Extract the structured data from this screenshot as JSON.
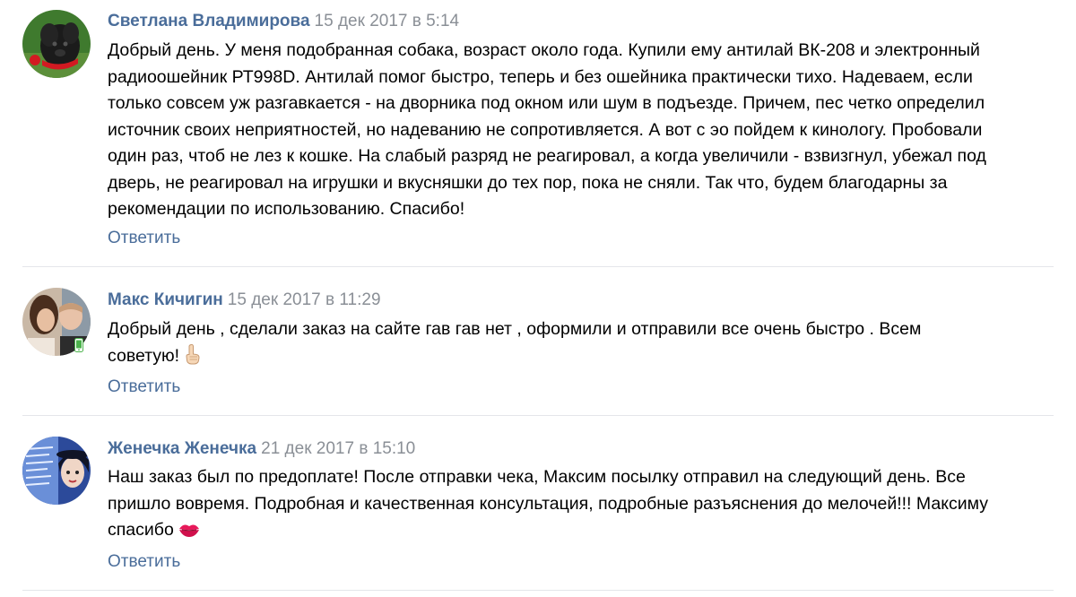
{
  "comments": [
    {
      "author": "Светлана Владимирова",
      "date": "15 дек 2017 в 5:14",
      "lines": [
        "Добрый день. У меня подобранная собака, возраст около года. Купили ему антилай ВК-208 и электронный",
        "радиоошейник РТ998D. Антилай помог быстро, теперь и без ошейника практически тихо. Надеваем, если",
        "только совсем уж разгавкается - на дворника под окном или шум в подъезде. Причем, пес четко определил",
        "источник своих неприятностей, но надеванию не сопротивляется. А вот с эо пойдем к кинологу. Пробовали",
        "один раз, чтоб не лез к кошке. На слабый разряд не реагировал, а когда увеличили - взвизгнул, убежал под",
        "дверь, не реагировал на игрушки и вкусняшки до тех пор, пока не сняли. Так что, будем благодарны за",
        "рекомендации по использованию. Спасибо!"
      ],
      "reply_label": "Ответить",
      "avatar_icon": "dog-avatar"
    },
    {
      "author": "Макс Кичигин",
      "date": "15 дек 2017 в 11:29",
      "lines": [
        "Добрый день , сделали заказ на сайте гав гав нет , оформили и отправили все очень быстро . Всем",
        "советую!"
      ],
      "emoji": "index-finger-up-emoji",
      "reply_label": "Ответить",
      "avatar_icon": "couple-photo-avatar",
      "status_icon": "mobile-online-icon"
    },
    {
      "author": "Женечка Женечка",
      "date": "21 дек 2017 в 15:10",
      "lines": [
        "Наш заказ был по предоплате! После отправки чека, Максим посылку отправил на следующий день. Все",
        "пришло вовремя. Подробная и качественная консультация, подробные разъяснения до мелочей!!! Максиму",
        "спасибо"
      ],
      "emoji": "kiss-lips-emoji",
      "reply_label": "Ответить",
      "avatar_icon": "blue-portrait-avatar"
    }
  ],
  "colors": {
    "link": "#4a6d9a",
    "date": "#8a8f96",
    "text": "#000000",
    "divider": "#e4e6ea",
    "online": "#4bb34b"
  }
}
